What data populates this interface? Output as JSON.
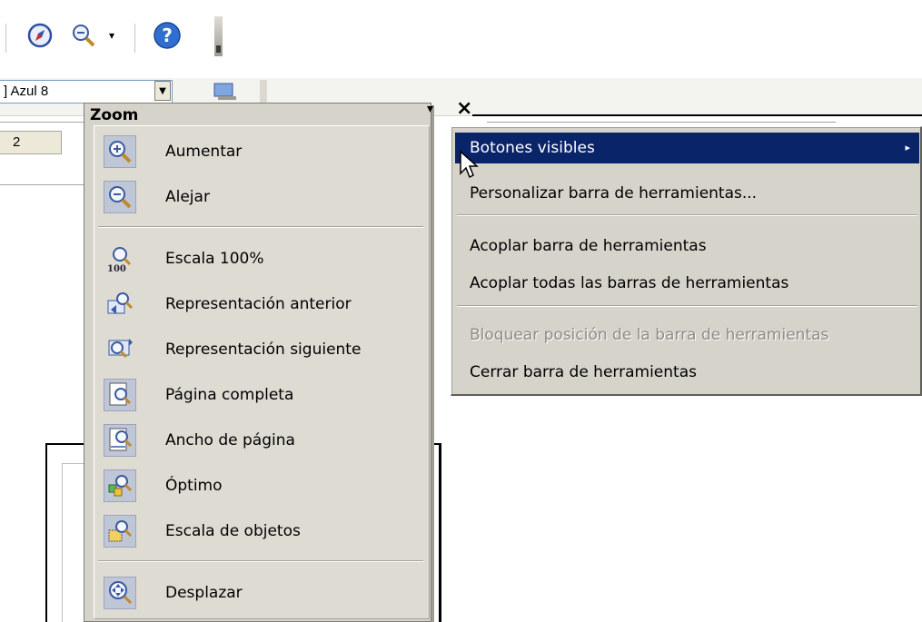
{
  "toolbar": {
    "color_combo_value": "] Azul 8",
    "page_number": "2"
  },
  "zoom_toolbar": {
    "title": "Zoom",
    "menu_arrow": "▾",
    "close_glyph": "×",
    "items": [
      {
        "label": "Aumentar",
        "icon": "zoom-in-icon"
      },
      {
        "label": "Alejar",
        "icon": "zoom-out-icon"
      },
      {
        "label": "Escala 100%",
        "icon": "zoom-100-icon"
      },
      {
        "label": "Representación anterior",
        "icon": "zoom-previous-icon"
      },
      {
        "label": "Representación siguiente",
        "icon": "zoom-next-icon"
      },
      {
        "label": "Página completa",
        "icon": "entire-page-icon"
      },
      {
        "label": "Ancho de página",
        "icon": "page-width-icon"
      },
      {
        "label": "Óptimo",
        "icon": "optimal-zoom-icon"
      },
      {
        "label": "Escala de objetos",
        "icon": "object-zoom-icon"
      },
      {
        "label": "Desplazar",
        "icon": "pan-icon"
      }
    ]
  },
  "context_menu": {
    "items": [
      {
        "label": "Botones visibles",
        "has_submenu": true,
        "active": true
      },
      {
        "label": "Personalizar barra de herramientas..."
      },
      {
        "label": "Acoplar barra de herramientas"
      },
      {
        "label": "Acoplar todas las barras de herramientas"
      },
      {
        "label": "Bloquear posición de la barra de herramientas",
        "disabled": true
      },
      {
        "label": "Cerrar barra de herramientas"
      }
    ],
    "submenu_arrow": "▸"
  },
  "colors": {
    "menu_bg": "#d6d3cb",
    "highlight": "#0a246a",
    "icon_box": "#bfc6d6"
  }
}
